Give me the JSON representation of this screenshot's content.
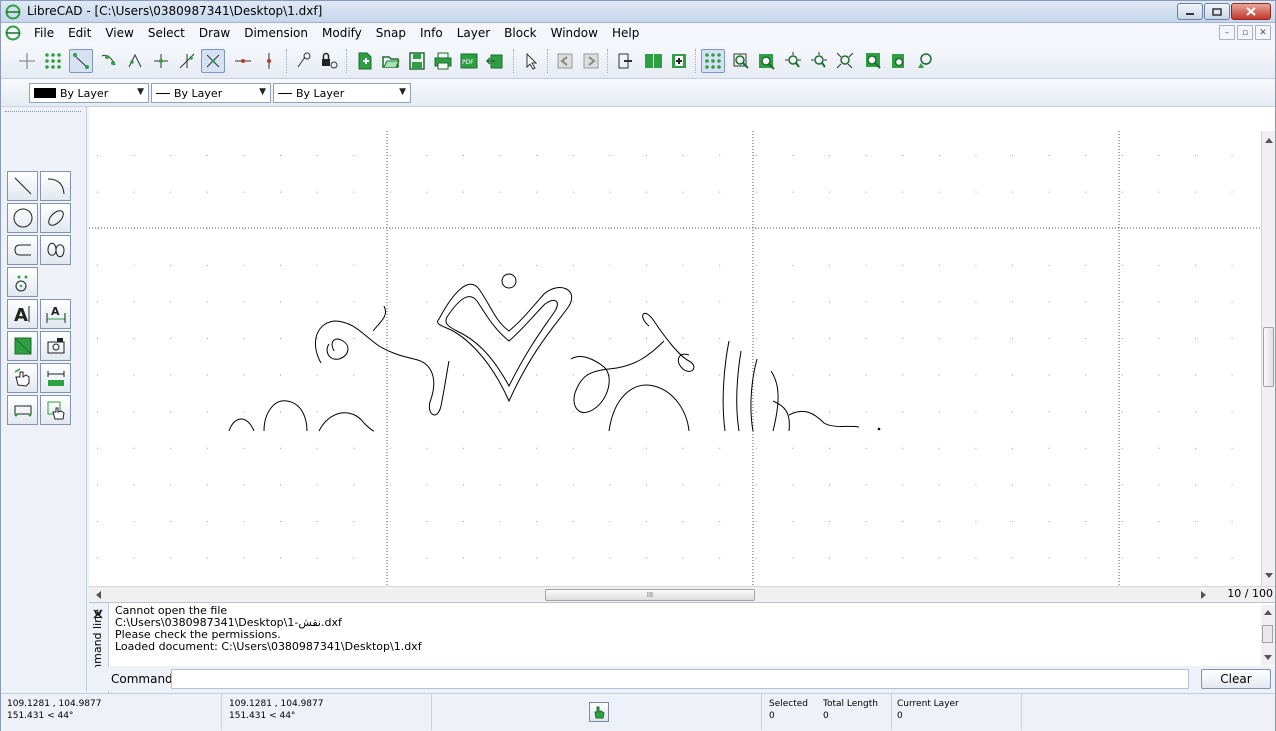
{
  "window": {
    "title": "LibreCAD - [C:\\Users\\0380987341\\Desktop\\1.dxf]"
  },
  "menu": {
    "items": [
      "File",
      "Edit",
      "View",
      "Select",
      "Draw",
      "Dimension",
      "Modify",
      "Snap",
      "Info",
      "Layer",
      "Block",
      "Window",
      "Help"
    ]
  },
  "toolbar2": {
    "color": "By Layer",
    "line_width": "By Layer",
    "line_type": "By Layer"
  },
  "view": {
    "zoom": "10 / 100",
    "hscroll_grip": "III"
  },
  "command": {
    "dock_title": "Command line",
    "lines": [
      "Cannot open the file",
      "C:\\Users\\0380987341\\Desktop\\1-نقش.dxf",
      "Please check the permissions.",
      "Loaded document: C:\\Users\\0380987341\\Desktop\\1.dxf"
    ],
    "label": "Command:",
    "value": "",
    "clear_label": "Clear"
  },
  "status": {
    "abs_coord": "109.1281 , 104.9877",
    "abs_polar": "151.431 < 44°",
    "rel_coord": "109.1281 , 104.9877",
    "rel_polar": "151.431 < 44°",
    "selected_label": "Selected",
    "selected_value": "0",
    "total_length_label": "Total Length",
    "total_length_value": "0",
    "current_layer_label": "Current Layer",
    "current_layer_value": "0"
  },
  "icons": {
    "app": "librecad-logo-icon",
    "colors": {
      "accent": "#c0392b",
      "green": "#2ea043"
    }
  }
}
